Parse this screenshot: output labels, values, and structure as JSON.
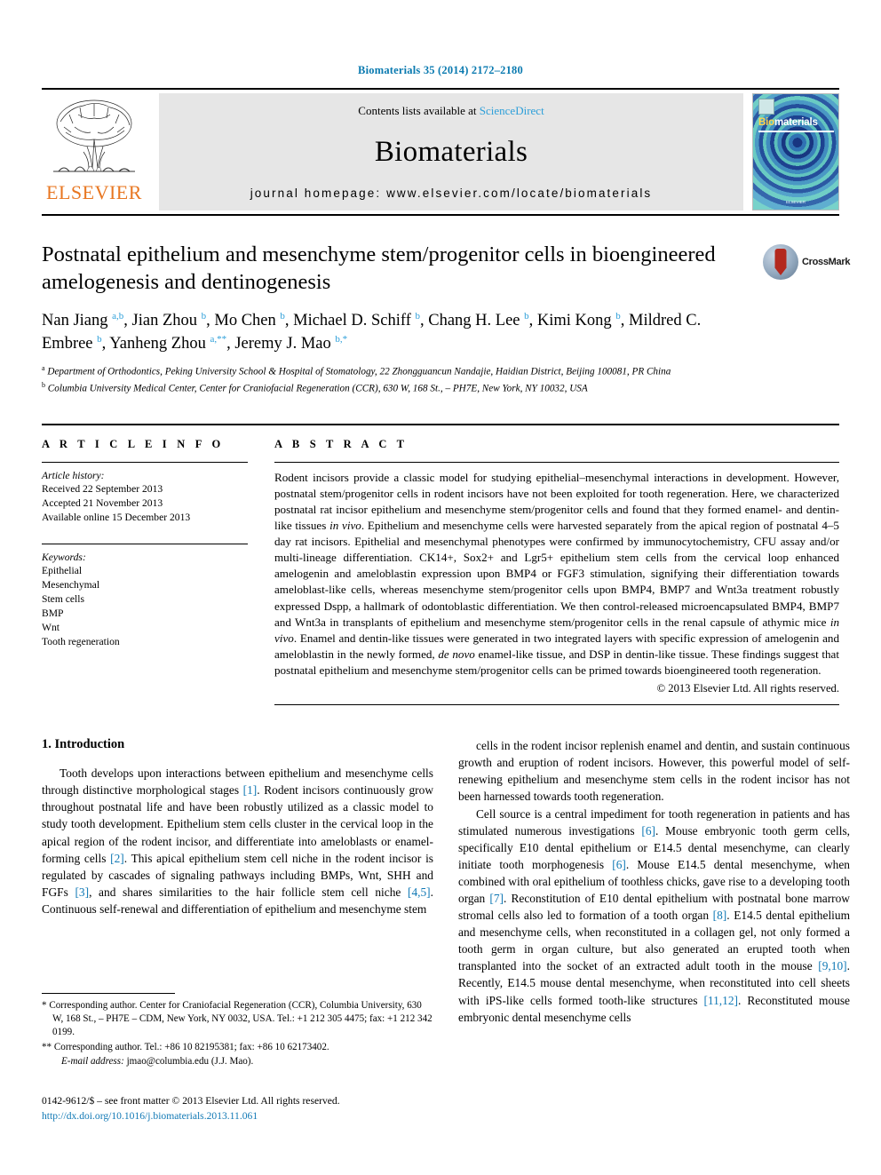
{
  "running_head": "Biomaterials 35 (2014) 2172–2180",
  "masthead": {
    "publisher_name": "ELSEVIER",
    "contents_prefix": "Contents lists available at ",
    "contents_link": "ScienceDirect",
    "journal_name": "Biomaterials",
    "homepage": "journal homepage: www.elsevier.com/locate/biomaterials",
    "cover": {
      "title_bold": "Bio",
      "title_rest": "materials",
      "footer": "ELSEVIER"
    }
  },
  "article": {
    "title": "Postnatal epithelium and mesenchyme stem/progenitor cells in bioengineered amelogenesis and dentinogenesis",
    "crossmark_label": "CrossMark",
    "authors_html": "Nan Jiang <sup>a,b</sup>, Jian Zhou <sup>b</sup>, Mo Chen <sup>b</sup>, Michael D. Schiff <sup>b</sup>, Chang H. Lee <sup>b</sup>, Kimi Kong <sup>b</sup>, Mildred C. Embree <sup>b</sup>, Yanheng Zhou <sup>a,**</sup>, Jeremy J. Mao <sup>b,*</sup>",
    "affiliation_a": "Department of Orthodontics, Peking University School & Hospital of Stomatology, 22 Zhongguancun Nandajie, Haidian District, Beijing 100081, PR China",
    "affiliation_b": "Columbia University Medical Center, Center for Craniofacial Regeneration (CCR), 630 W, 168 St., – PH7E, New York, NY 10032, USA"
  },
  "article_info": {
    "heading": "A R T I C L E   I N F O",
    "history_label": "Article history:",
    "history": [
      "Received 22 September 2013",
      "Accepted 21 November 2013",
      "Available online 15 December 2013"
    ],
    "keywords_label": "Keywords:",
    "keywords": [
      "Epithelial",
      "Mesenchymal",
      "Stem cells",
      "BMP",
      "Wnt",
      "Tooth regeneration"
    ]
  },
  "abstract": {
    "heading": "A B S T R A C T",
    "text_html": "Rodent incisors provide a classic model for studying epithelial–mesenchymal interactions in development. However, postnatal stem/progenitor cells in rodent incisors have not been exploited for tooth regeneration. Here, we characterized postnatal rat incisor epithelium and mesenchyme stem/progenitor cells and found that they formed enamel- and dentin-like tissues <i>in vivo</i>. Epithelium and mesenchyme cells were harvested separately from the apical region of postnatal 4–5 day rat incisors. Epithelial and mesenchymal phenotypes were confirmed by immunocytochemistry, CFU assay and/or multi-lineage differentiation. CK14+, Sox2+ and Lgr5+ epithelium stem cells from the cervical loop enhanced amelogenin and ameloblastin expression upon BMP4 or FGF3 stimulation, signifying their differentiation towards ameloblast-like cells, whereas mesenchyme stem/progenitor cells upon BMP4, BMP7 and Wnt3a treatment robustly expressed Dspp, a hallmark of odontoblastic differentiation. We then control-released microencapsulated BMP4, BMP7 and Wnt3a in transplants of epithelium and mesenchyme stem/progenitor cells in the renal capsule of athymic mice <i>in vivo</i>. Enamel and dentin-like tissues were generated in two integrated layers with specific expression of amelogenin and ameloblastin in the newly formed, <i>de novo</i> enamel-like tissue, and DSP in dentin-like tissue. These findings suggest that postnatal epithelium and mesenchyme stem/progenitor cells can be primed towards bioengineered tooth regeneration.",
    "copyright": "© 2013 Elsevier Ltd. All rights reserved."
  },
  "body": {
    "section_heading": "1. Introduction",
    "left_paragraph_html": "Tooth develops upon interactions between epithelium and mesenchyme cells through distinctive morphological stages <span class=\"cit\">[1]</span>. Rodent incisors continuously grow throughout postnatal life and have been robustly utilized as a classic model to study tooth development. Epithelium stem cells cluster in the cervical loop in the apical region of the rodent incisor, and differentiate into ameloblasts or enamel-forming cells <span class=\"cit\">[2]</span>. This apical epithelium stem cell niche in the rodent incisor is regulated by cascades of signaling pathways including BMPs, Wnt, SHH and FGFs <span class=\"cit\">[3]</span>, and shares similarities to the hair follicle stem cell niche <span class=\"cit\">[4,5]</span>. Continuous self-renewal and differentiation of epithelium and mesenchyme stem",
    "right_paragraph1_html": "cells in the rodent incisor replenish enamel and dentin, and sustain continuous growth and eruption of rodent incisors. However, this powerful model of self-renewing epithelium and mesenchyme stem cells in the rodent incisor has not been harnessed towards tooth regeneration.",
    "right_paragraph2_html": "Cell source is a central impediment for tooth regeneration in patients and has stimulated numerous investigations <span class=\"cit\">[6]</span>. Mouse embryonic tooth germ cells, specifically E10 dental epithelium or E14.5 dental mesenchyme, can clearly initiate tooth morphogenesis <span class=\"cit\">[6]</span>. Mouse E14.5 dental mesenchyme, when combined with oral epithelium of toothless chicks, gave rise to a developing tooth organ <span class=\"cit\">[7]</span>. Reconstitution of E10 dental epithelium with postnatal bone marrow stromal cells also led to formation of a tooth organ <span class=\"cit\">[8]</span>. E14.5 dental epithelium and mesenchyme cells, when reconstituted in a collagen gel, not only formed a tooth germ in organ culture, but also generated an erupted tooth when transplanted into the socket of an extracted adult tooth in the mouse <span class=\"cit\">[9,10]</span>. Recently, E14.5 mouse dental mesenchyme, when reconstituted into cell sheets with iPS-like cells formed tooth-like structures <span class=\"cit\">[11,12]</span>. Reconstituted mouse embryonic dental mesenchyme cells"
  },
  "footnotes": {
    "note1_html": "<span class=\"marker\">*</span> Corresponding author. Center for Craniofacial Regeneration (CCR), Columbia University, 630 W, 168 St., – PH7E – CDM, New York, NY 0032, USA. Tel.: +1 212 305 4475; fax: +1 212 342 0199.",
    "note2_html": "<span class=\"marker\">**</span> Corresponding author. Tel.: +86 10 82195381; fax: +86 10 62173402.",
    "email_html": "<i>E-mail address:</i> <span class=\"doi\">jmao@columbia.edu</span> (J.J. Mao).",
    "issn_line": "0142-9612/$ – see front matter © 2013 Elsevier Ltd. All rights reserved.",
    "doi": "http://dx.doi.org/10.1016/j.biomaterials.2013.11.061"
  }
}
